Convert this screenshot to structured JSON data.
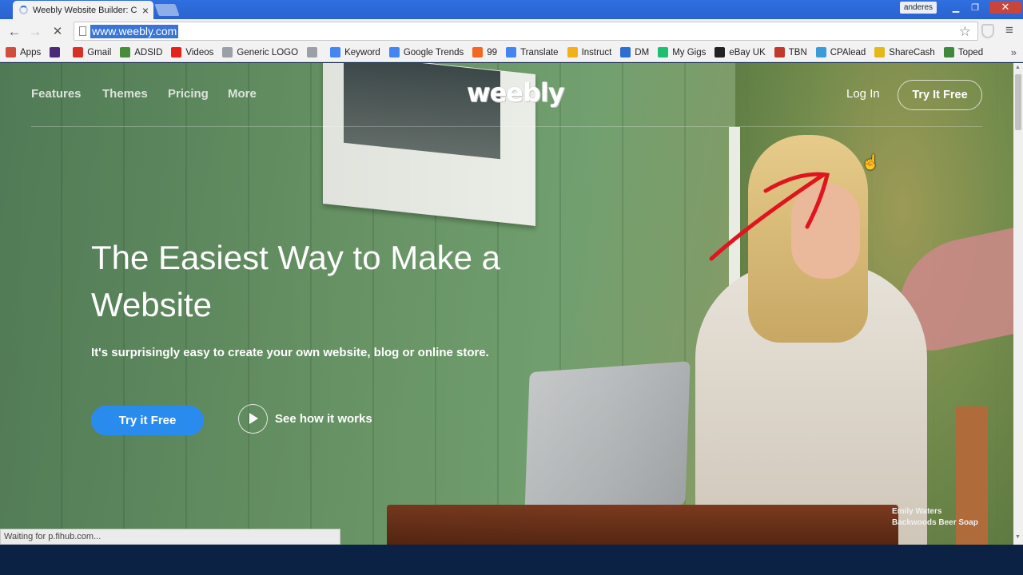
{
  "browser": {
    "tab_title": "Weebly Website Builder: C",
    "url": "www.weebly.com",
    "profile": "anderes",
    "status": "Waiting for p.fihub.com..."
  },
  "bookmarks": [
    {
      "label": "Apps",
      "icon": "apps-icon",
      "color": "#d04e3b"
    },
    {
      "label": "",
      "icon": "mail-icon",
      "color": "#4b2a7a"
    },
    {
      "label": "Gmail",
      "icon": "gmail-icon",
      "color": "#d93025"
    },
    {
      "label": "ADSID",
      "icon": "adsid-icon",
      "color": "#4a8c3a"
    },
    {
      "label": "Videos",
      "icon": "youtube-icon",
      "color": "#e62117"
    },
    {
      "label": "Generic LOGO",
      "icon": "page-icon",
      "color": "#9aa0a6"
    },
    {
      "label": "",
      "icon": "page-icon",
      "color": "#9aa0a6"
    },
    {
      "label": "Keyword",
      "icon": "adwords-icon",
      "color": "#4285f4"
    },
    {
      "label": "Google Trends",
      "icon": "google-icon",
      "color": "#4285f4"
    },
    {
      "label": "99",
      "icon": "99designs-icon",
      "color": "#f26722"
    },
    {
      "label": "Translate",
      "icon": "translate-icon",
      "color": "#4285f4"
    },
    {
      "label": "Instruct",
      "icon": "instruct-icon",
      "color": "#f2b11a"
    },
    {
      "label": "DM",
      "icon": "dm-icon",
      "color": "#2b6fd0"
    },
    {
      "label": "My Gigs",
      "icon": "fiverr-icon",
      "color": "#1dbf73"
    },
    {
      "label": "eBay UK",
      "icon": "ebay-icon",
      "color": "#222222"
    },
    {
      "label": "TBN",
      "icon": "tbn-icon",
      "color": "#c0392b"
    },
    {
      "label": "CPAlead",
      "icon": "cpalead-icon",
      "color": "#3a9bd9"
    },
    {
      "label": "ShareCash",
      "icon": "sharecash-icon",
      "color": "#e5b81a"
    },
    {
      "label": "Toped",
      "icon": "toped-icon",
      "color": "#3e8a3a"
    }
  ],
  "site": {
    "nav": {
      "features": "Features",
      "themes": "Themes",
      "pricing": "Pricing",
      "more": "More",
      "logo": "weebly",
      "login": "Log In",
      "try_free": "Try It Free"
    },
    "hero": {
      "title": "The Easiest Way to Make a Website",
      "subtitle": "It's surprisingly easy to create your own website, blog or online store.",
      "cta": "Try it Free",
      "video_link": "See how it works"
    },
    "credit": {
      "name": "Emily Waters",
      "business": "Backwoods Beer Soap"
    }
  },
  "colors": {
    "accent": "#2a8bef",
    "annotation": "#e0141e"
  }
}
